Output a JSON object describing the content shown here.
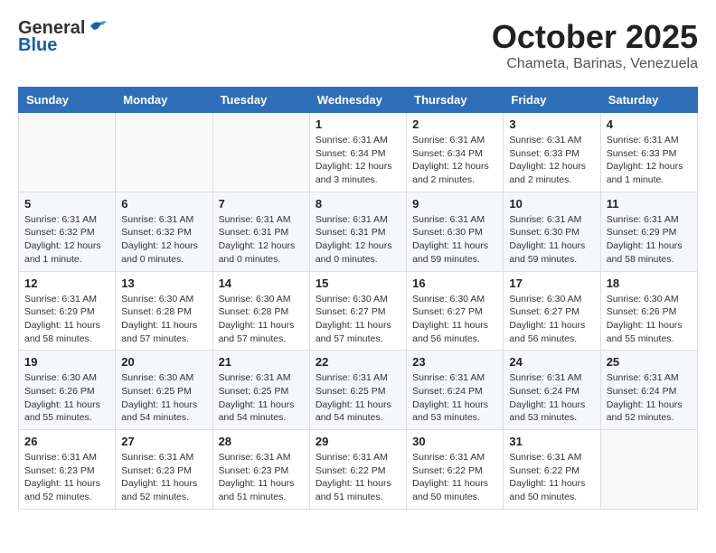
{
  "header": {
    "logo_general": "General",
    "logo_blue": "Blue",
    "month": "October 2025",
    "location": "Chameta, Barinas, Venezuela"
  },
  "weekdays": [
    "Sunday",
    "Monday",
    "Tuesday",
    "Wednesday",
    "Thursday",
    "Friday",
    "Saturday"
  ],
  "weeks": [
    [
      {
        "day": "",
        "info": ""
      },
      {
        "day": "",
        "info": ""
      },
      {
        "day": "",
        "info": ""
      },
      {
        "day": "1",
        "info": "Sunrise: 6:31 AM\nSunset: 6:34 PM\nDaylight: 12 hours and 3 minutes."
      },
      {
        "day": "2",
        "info": "Sunrise: 6:31 AM\nSunset: 6:34 PM\nDaylight: 12 hours and 2 minutes."
      },
      {
        "day": "3",
        "info": "Sunrise: 6:31 AM\nSunset: 6:33 PM\nDaylight: 12 hours and 2 minutes."
      },
      {
        "day": "4",
        "info": "Sunrise: 6:31 AM\nSunset: 6:33 PM\nDaylight: 12 hours and 1 minute."
      }
    ],
    [
      {
        "day": "5",
        "info": "Sunrise: 6:31 AM\nSunset: 6:32 PM\nDaylight: 12 hours and 1 minute."
      },
      {
        "day": "6",
        "info": "Sunrise: 6:31 AM\nSunset: 6:32 PM\nDaylight: 12 hours and 0 minutes."
      },
      {
        "day": "7",
        "info": "Sunrise: 6:31 AM\nSunset: 6:31 PM\nDaylight: 12 hours and 0 minutes."
      },
      {
        "day": "8",
        "info": "Sunrise: 6:31 AM\nSunset: 6:31 PM\nDaylight: 12 hours and 0 minutes."
      },
      {
        "day": "9",
        "info": "Sunrise: 6:31 AM\nSunset: 6:30 PM\nDaylight: 11 hours and 59 minutes."
      },
      {
        "day": "10",
        "info": "Sunrise: 6:31 AM\nSunset: 6:30 PM\nDaylight: 11 hours and 59 minutes."
      },
      {
        "day": "11",
        "info": "Sunrise: 6:31 AM\nSunset: 6:29 PM\nDaylight: 11 hours and 58 minutes."
      }
    ],
    [
      {
        "day": "12",
        "info": "Sunrise: 6:31 AM\nSunset: 6:29 PM\nDaylight: 11 hours and 58 minutes."
      },
      {
        "day": "13",
        "info": "Sunrise: 6:30 AM\nSunset: 6:28 PM\nDaylight: 11 hours and 57 minutes."
      },
      {
        "day": "14",
        "info": "Sunrise: 6:30 AM\nSunset: 6:28 PM\nDaylight: 11 hours and 57 minutes."
      },
      {
        "day": "15",
        "info": "Sunrise: 6:30 AM\nSunset: 6:27 PM\nDaylight: 11 hours and 57 minutes."
      },
      {
        "day": "16",
        "info": "Sunrise: 6:30 AM\nSunset: 6:27 PM\nDaylight: 11 hours and 56 minutes."
      },
      {
        "day": "17",
        "info": "Sunrise: 6:30 AM\nSunset: 6:27 PM\nDaylight: 11 hours and 56 minutes."
      },
      {
        "day": "18",
        "info": "Sunrise: 6:30 AM\nSunset: 6:26 PM\nDaylight: 11 hours and 55 minutes."
      }
    ],
    [
      {
        "day": "19",
        "info": "Sunrise: 6:30 AM\nSunset: 6:26 PM\nDaylight: 11 hours and 55 minutes."
      },
      {
        "day": "20",
        "info": "Sunrise: 6:30 AM\nSunset: 6:25 PM\nDaylight: 11 hours and 54 minutes."
      },
      {
        "day": "21",
        "info": "Sunrise: 6:31 AM\nSunset: 6:25 PM\nDaylight: 11 hours and 54 minutes."
      },
      {
        "day": "22",
        "info": "Sunrise: 6:31 AM\nSunset: 6:25 PM\nDaylight: 11 hours and 54 minutes."
      },
      {
        "day": "23",
        "info": "Sunrise: 6:31 AM\nSunset: 6:24 PM\nDaylight: 11 hours and 53 minutes."
      },
      {
        "day": "24",
        "info": "Sunrise: 6:31 AM\nSunset: 6:24 PM\nDaylight: 11 hours and 53 minutes."
      },
      {
        "day": "25",
        "info": "Sunrise: 6:31 AM\nSunset: 6:24 PM\nDaylight: 11 hours and 52 minutes."
      }
    ],
    [
      {
        "day": "26",
        "info": "Sunrise: 6:31 AM\nSunset: 6:23 PM\nDaylight: 11 hours and 52 minutes."
      },
      {
        "day": "27",
        "info": "Sunrise: 6:31 AM\nSunset: 6:23 PM\nDaylight: 11 hours and 52 minutes."
      },
      {
        "day": "28",
        "info": "Sunrise: 6:31 AM\nSunset: 6:23 PM\nDaylight: 11 hours and 51 minutes."
      },
      {
        "day": "29",
        "info": "Sunrise: 6:31 AM\nSunset: 6:22 PM\nDaylight: 11 hours and 51 minutes."
      },
      {
        "day": "30",
        "info": "Sunrise: 6:31 AM\nSunset: 6:22 PM\nDaylight: 11 hours and 50 minutes."
      },
      {
        "day": "31",
        "info": "Sunrise: 6:31 AM\nSunset: 6:22 PM\nDaylight: 11 hours and 50 minutes."
      },
      {
        "day": "",
        "info": ""
      }
    ]
  ]
}
